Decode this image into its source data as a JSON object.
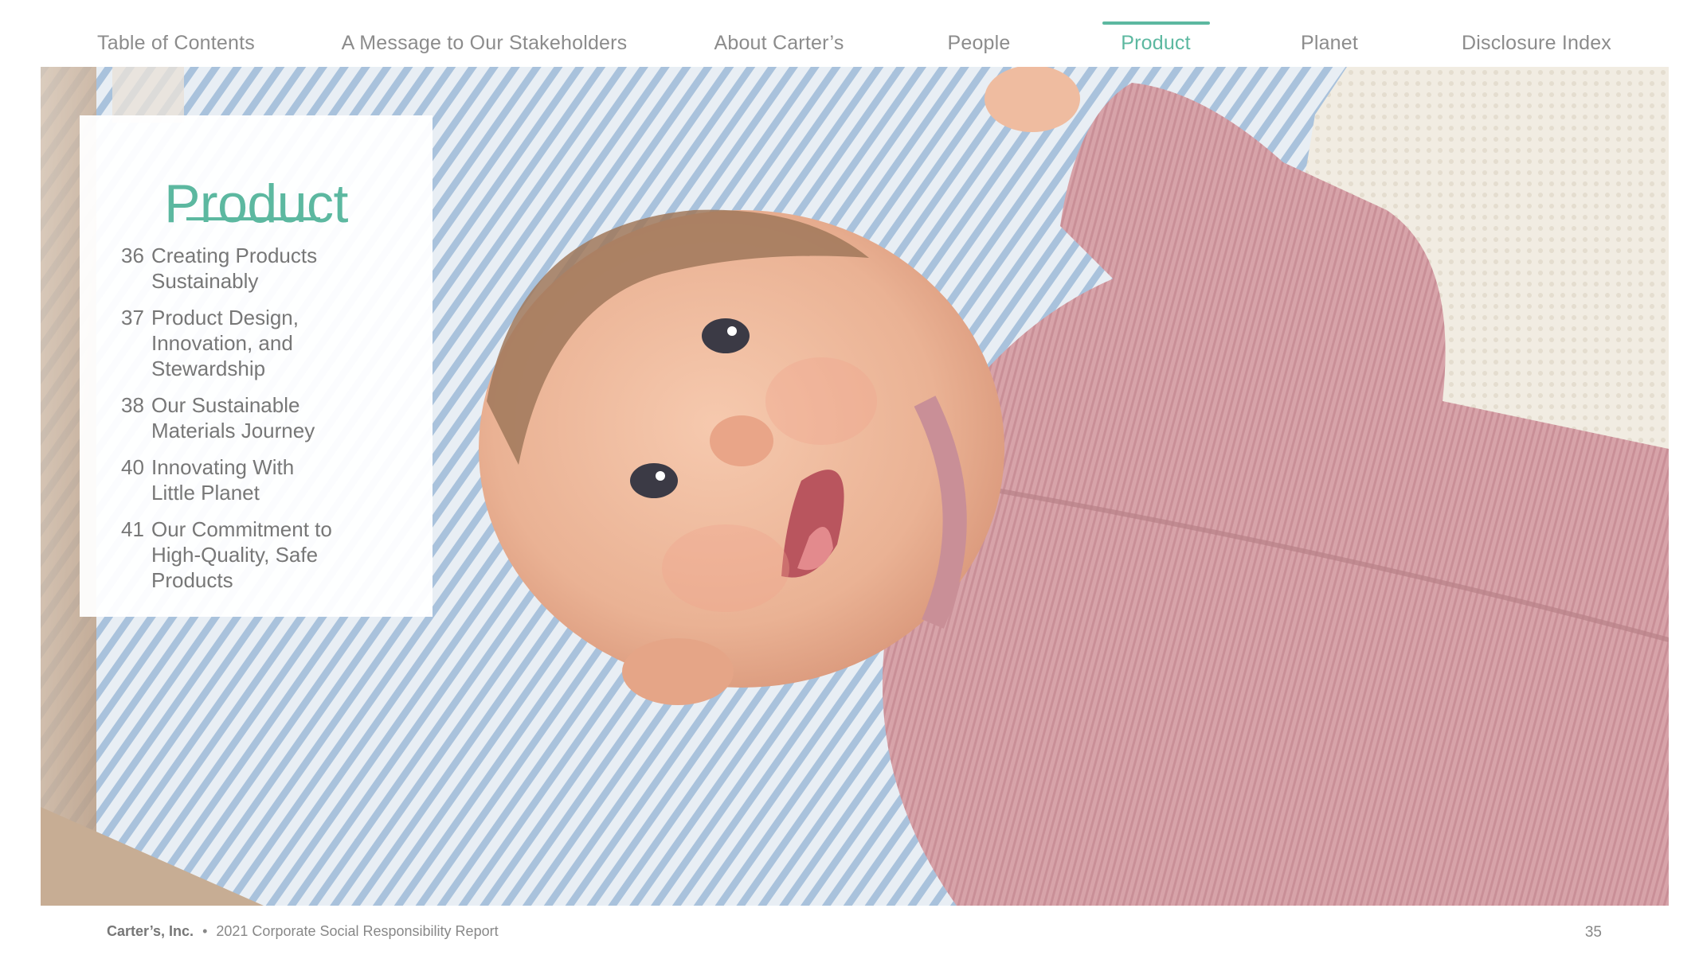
{
  "nav": {
    "items": [
      {
        "label": "Table of Contents"
      },
      {
        "label": "A Message to Our Stakeholders"
      },
      {
        "label": "About Carter’s"
      },
      {
        "label": "People"
      },
      {
        "label": "Product"
      },
      {
        "label": "Planet"
      },
      {
        "label": "Disclosure Index"
      }
    ],
    "active": "Product"
  },
  "section": {
    "title": "Product",
    "contents": [
      {
        "page": "36",
        "text": "Creating Products Sustainably"
      },
      {
        "page": "37",
        "text": "Product Design, Innovation, and Stewardship"
      },
      {
        "page": "38",
        "text": "Our Sustainable Materials Journey"
      },
      {
        "page": "40",
        "text": "Innovating With Little Planet"
      },
      {
        "page": "41",
        "text": "Our Commitment to High-Quality, Safe Products"
      }
    ]
  },
  "footer": {
    "company": "Carter’s, Inc.",
    "separator": "•",
    "report": "2021 Corporate Social Responsibility Report",
    "page_number": "35"
  },
  "colors": {
    "accent": "#5cb8a0",
    "text": "#7a7a7a"
  }
}
